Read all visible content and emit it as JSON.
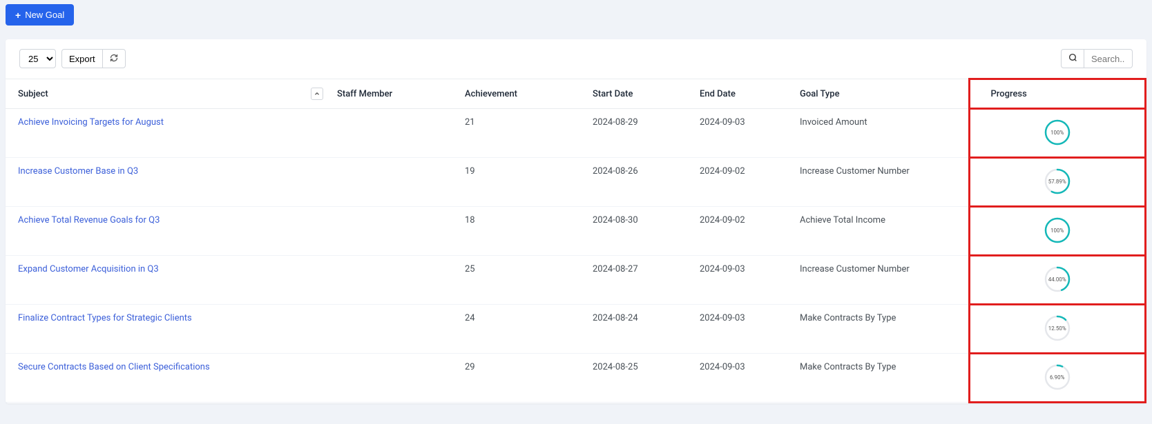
{
  "actions": {
    "new_goal": "New Goal",
    "export": "Export"
  },
  "page_size_options": [
    "25"
  ],
  "search": {
    "placeholder": "Search.."
  },
  "columns": {
    "subject": "Subject",
    "staff": "Staff Member",
    "achievement": "Achievement",
    "start": "Start Date",
    "end": "End Date",
    "type": "Goal Type",
    "progress": "Progress"
  },
  "rows": [
    {
      "subject": "Achieve Invoicing Targets for August",
      "staff": "",
      "achievement": "21",
      "start": "2024-08-29",
      "end": "2024-09-03",
      "type": "Invoiced Amount",
      "progress_pct": 100,
      "progress_label": "100%"
    },
    {
      "subject": "Increase Customer Base in Q3",
      "staff": "",
      "achievement": "19",
      "start": "2024-08-26",
      "end": "2024-09-02",
      "type": "Increase Customer Number",
      "progress_pct": 57.89,
      "progress_label": "57.89%"
    },
    {
      "subject": "Achieve Total Revenue Goals for Q3",
      "staff": "",
      "achievement": "18",
      "start": "2024-08-30",
      "end": "2024-09-02",
      "type": "Achieve Total Income",
      "progress_pct": 100,
      "progress_label": "100%"
    },
    {
      "subject": "Expand Customer Acquisition in Q3",
      "staff": "",
      "achievement": "25",
      "start": "2024-08-27",
      "end": "2024-09-03",
      "type": "Increase Customer Number",
      "progress_pct": 44.0,
      "progress_label": "44.00%"
    },
    {
      "subject": "Finalize Contract Types for Strategic Clients",
      "staff": "",
      "achievement": "24",
      "start": "2024-08-24",
      "end": "2024-09-03",
      "type": "Make Contracts By Type",
      "progress_pct": 12.5,
      "progress_label": "12.50%"
    },
    {
      "subject": "Secure Contracts Based on Client Specifications",
      "staff": "",
      "achievement": "29",
      "start": "2024-08-25",
      "end": "2024-09-03",
      "type": "Make Contracts By Type",
      "progress_pct": 6.9,
      "progress_label": "6.90%"
    }
  ]
}
